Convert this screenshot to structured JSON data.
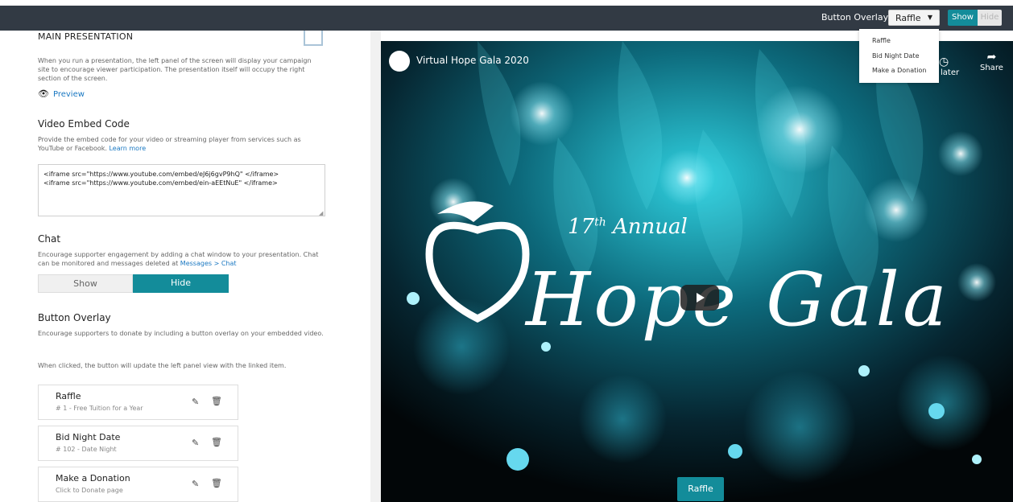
{
  "topbar": {
    "overlay_label": "Button Overlay:",
    "overlay_selected": "Raffle",
    "show_label": "Show",
    "hide_label": "Hide"
  },
  "dropdown": {
    "items": [
      "Raffle",
      "Bid Night Date",
      "Make a Donation"
    ]
  },
  "main_presentation": {
    "title": "MAIN PRESENTATION",
    "description": "When you run a presentation, the left panel of the screen will display your campaign site to encourage viewer participation. The presentation itself will occupy the right section of the screen.",
    "preview_label": "Preview"
  },
  "video_embed": {
    "title": "Video Embed Code",
    "description": "Provide the embed code for your video or streaming player from services such as YouTube or Facebook.",
    "learn_more": "Learn more",
    "code": "<iframe src=\"https://www.youtube.com/embed/eJ6j6gvP9hQ\" </iframe>\n<iframe src=\"https://www.youtube.com/embed/ein-aEEtNuE\" </iframe>"
  },
  "chat": {
    "title": "Chat",
    "description": "Encourage supporter engagement by adding a chat window to your presentation. Chat can be monitored and messages deleted at",
    "link": "Messages > Chat",
    "show_label": "Show",
    "hide_label": "Hide"
  },
  "button_overlay": {
    "title": "Button Overlay",
    "description": "Encourage supporters to donate by including a button overlay on your embedded video.",
    "description2": "When clicked, the button will update the left panel view with the linked item.",
    "items": [
      {
        "title": "Raffle",
        "subtitle": "# 1 - Free Tuition for a Year"
      },
      {
        "title": "Bid Night Date",
        "subtitle": "# 102 - Date Night"
      },
      {
        "title": "Make a Donation",
        "subtitle": "Click to Donate page"
      }
    ]
  },
  "video": {
    "title": "Virtual Hope Gala 2020",
    "watch_later": "ch later",
    "share": "Share",
    "annual_num": "17",
    "annual_suffix": "th",
    "annual_word": "Annual",
    "hope_gala": "Hope Gala",
    "overlay_button": "Raffle"
  },
  "colors": {
    "accent": "#138c9a",
    "topbar": "#323a44",
    "link": "#1a78c2"
  }
}
